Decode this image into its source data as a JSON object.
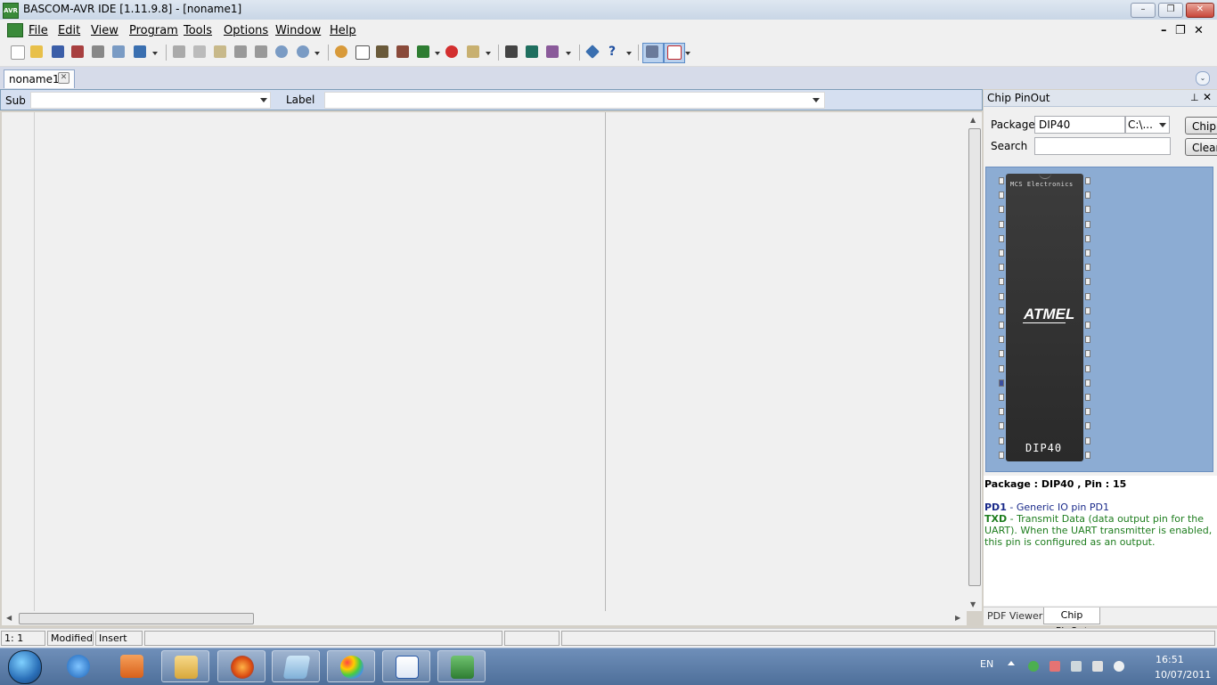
{
  "window": {
    "title": "BASCOM-AVR IDE [1.11.9.8] - [noname1]",
    "controls": {
      "minimize": "–",
      "restore": "❐",
      "close": "✕"
    }
  },
  "menu": {
    "items": [
      "File",
      "Edit",
      "View",
      "Program",
      "Tools",
      "Options",
      "Window",
      "Help"
    ],
    "mdi_controls": {
      "minimize": "–",
      "restore": "❐",
      "close": "✕"
    }
  },
  "toolbar": {
    "icons": [
      "new-file-icon",
      "open-folder-icon",
      "save-icon",
      "save-all-icon",
      "print-icon",
      "print-preview-icon",
      "export-icon",
      "cut-icon",
      "copy-icon",
      "paste-icon",
      "indent-icon",
      "unindent-icon",
      "find-icon",
      "find-next-icon",
      "compile-icon",
      "syntax-check-icon",
      "chip-icon",
      "chip-programmer-icon",
      "run-programmer-icon",
      "stop-icon",
      "simulator-icon",
      "terminal-icon",
      "lcd-designer-icon",
      "graphic-converter-icon",
      "info-icon",
      "help-icon",
      "pinout-icon",
      "pdf-icon"
    ]
  },
  "tabs": {
    "document": "noname1",
    "close_glyph": "✕",
    "menu_glyph": "⌄"
  },
  "sub_label_bar": {
    "sub_label": "Sub",
    "sub_value": "",
    "label_label": "Label",
    "label_value": ""
  },
  "scroll": {
    "up": "▲",
    "down": "▼",
    "left": "◀",
    "right": "▶"
  },
  "chip_pinout": {
    "panel_title": "Chip PinOut",
    "pin_glyph": "⊥",
    "close_glyph": "✕",
    "package_label": "Package",
    "package_value": "DIP40",
    "package_path": "C:\\...",
    "search_label": "Search",
    "search_value": "",
    "chip_button": "Chip",
    "clear_button": "Clear",
    "chip_maker": "MCS Electronics",
    "chip_logo": "ATMEL",
    "chip_label": "DIP40",
    "pin_count": 40,
    "info_title": "Package : DIP40 , Pin : 15",
    "pin_name_1": "PD1",
    "pin_desc_1": " - Generic IO pin PD1",
    "pin_name_2": "TXD",
    "pin_desc_2": " - Transmit Data (data output pin for the UART). When the UART transmitter is enabled, this pin is configured as an output.",
    "tabs": [
      "PDF Viewer",
      "Chip PinOut"
    ]
  },
  "status": {
    "position": "1: 1",
    "modified": "Modified",
    "mode": "Insert",
    "cell4": "",
    "cell5": "",
    "cell6": ""
  },
  "taskbar": {
    "apps": [
      "internet-explorer-icon",
      "media-player-icon",
      "windows-explorer-icon",
      "firefox-icon",
      "notepad-icon",
      "paint-icon",
      "word-icon",
      "bascom-avr-icon"
    ],
    "language": "EN",
    "time": "16:51",
    "date": "10/07/2011"
  },
  "colors": {
    "accent": "#d5dff0",
    "chip_bg": "#8cacd3",
    "pin_name": "#1a2a8a",
    "pin_text": "#1e7d1e"
  }
}
